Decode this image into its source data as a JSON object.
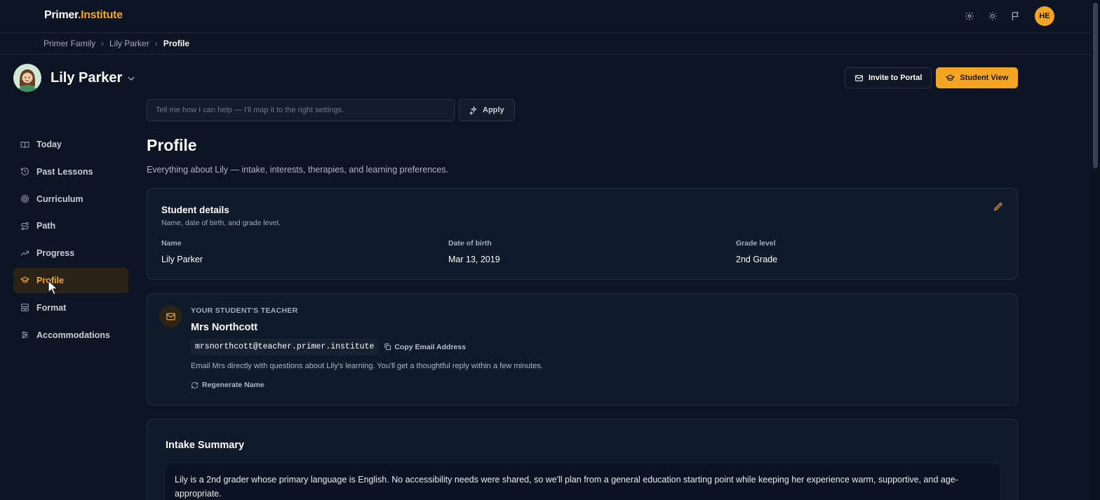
{
  "brand": {
    "part1": "Primer",
    "part2": ".Institute"
  },
  "topbar": {
    "user_initials": "HE"
  },
  "breadcrumb": {
    "items": [
      "Primer Family",
      "Lily Parker"
    ],
    "current": "Profile"
  },
  "student": {
    "name": "Lily Parker"
  },
  "actions": {
    "invite_label": "Invite to Portal",
    "student_view_label": "Student View"
  },
  "help": {
    "placeholder": "Tell me how I can help — I'll map it to the right settings.",
    "apply_label": "Apply"
  },
  "sidebar": {
    "items": [
      {
        "label": "Today",
        "icon": "book-open-icon"
      },
      {
        "label": "Past Lessons",
        "icon": "history-icon"
      },
      {
        "label": "Curriculum",
        "icon": "target-icon"
      },
      {
        "label": "Path",
        "icon": "route-icon"
      },
      {
        "label": "Progress",
        "icon": "trending-up-icon"
      },
      {
        "label": "Profile",
        "icon": "graduation-cap-icon",
        "active": true
      },
      {
        "label": "Format",
        "icon": "layout-icon"
      },
      {
        "label": "Accommodations",
        "icon": "sliders-icon"
      }
    ]
  },
  "page": {
    "title": "Profile",
    "subtitle": "Everything about Lily — intake, interests, therapies, and learning preferences."
  },
  "student_details": {
    "title": "Student details",
    "subtitle": "Name, date of birth, and grade level.",
    "fields": [
      {
        "label": "Name",
        "value": "Lily Parker"
      },
      {
        "label": "Date of birth",
        "value": "Mar 13, 2019"
      },
      {
        "label": "Grade level",
        "value": "2nd Grade"
      }
    ]
  },
  "teacher": {
    "kicker": "YOUR STUDENT'S TEACHER",
    "name": "Mrs Northcott",
    "email": "mrsnorthcott@teacher.primer.institute",
    "copy_label": "Copy Email Address",
    "description": "Email Mrs directly with questions about Lily's learning. You'll get a thoughtful reply within a few minutes.",
    "regenerate_label": "Regenerate Name"
  },
  "intake": {
    "title": "Intake Summary",
    "text": "Lily is a 2nd grader whose primary language is English. No accessibility needs were shared, so we'll plan from a general education starting point while keeping her experience warm, supportive, and age-appropriate."
  },
  "colors": {
    "accent": "#f5a524",
    "background": "#0d1424",
    "card": "#111a2a"
  }
}
